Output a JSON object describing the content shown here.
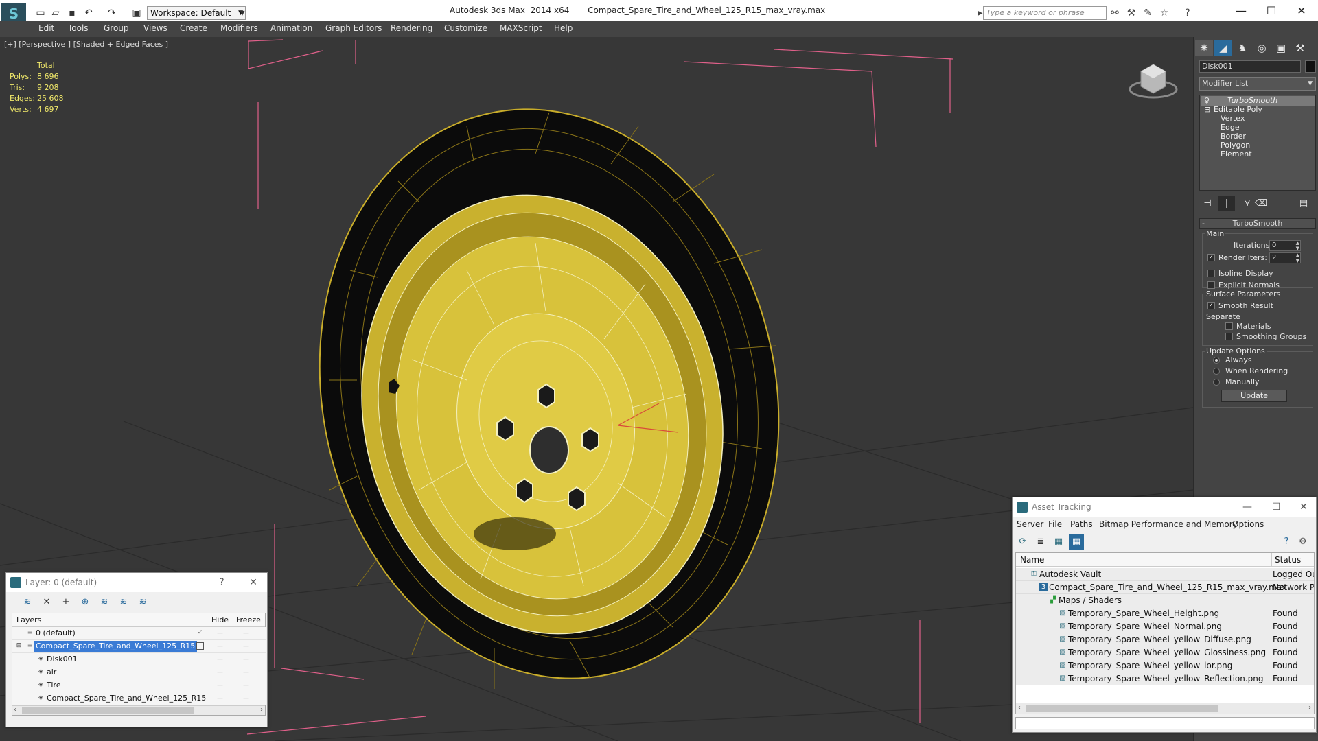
{
  "titlebar": {
    "workspace": "Workspace: Default",
    "app_title": "Autodesk 3ds Max  2014 x64",
    "file_name": "Compact_Spare_Tire_and_Wheel_125_R15_max_vray.max",
    "search_placeholder": "Type a keyword or phrase"
  },
  "menu": [
    "Edit",
    "Tools",
    "Group",
    "Views",
    "Create",
    "Modifiers",
    "Animation",
    "Graph Editors",
    "Rendering",
    "Customize",
    "MAXScript",
    "Help"
  ],
  "viewport": {
    "label": "[+] [Perspective ] [Shaded + Edged Faces ]",
    "stats": {
      "header": "Total",
      "rows": [
        {
          "key": "Polys:",
          "value": "8 696"
        },
        {
          "key": "Tris:",
          "value": "9 208"
        },
        {
          "key": "Edges:",
          "value": "25 608"
        },
        {
          "key": "Verts:",
          "value": "4 697"
        }
      ]
    },
    "colors": {
      "background": "#373737",
      "wire": "#e8d23a",
      "rim": "#c9b12e",
      "tire": "#0b0b0b",
      "bbox": "#e0608a"
    }
  },
  "command_panel": {
    "object_name": "Disk001",
    "modifier_list": "Modifier List",
    "stack": {
      "modifier": "TurboSmooth",
      "base": "Editable Poly",
      "sub_objects": [
        "Vertex",
        "Edge",
        "Border",
        "Polygon",
        "Element"
      ]
    },
    "turbosmooth": {
      "title": "TurboSmooth",
      "main_group": "Main",
      "iterations_label": "Iterations:",
      "iterations_value": "0",
      "render_iters_label": "Render Iters:",
      "render_iters_value": "2",
      "isoline_label": "Isoline Display",
      "explicit_label": "Explicit Normals",
      "surface_group": "Surface Parameters",
      "smooth_result_label": "Smooth Result",
      "separate_label": "Separate",
      "materials_label": "Materials",
      "smoothing_groups_label": "Smoothing Groups",
      "update_group": "Update Options",
      "always_label": "Always",
      "when_rendering_label": "When Rendering",
      "manually_label": "Manually",
      "update_button": "Update"
    }
  },
  "layer_window": {
    "title": "Layer: 0 (default)",
    "help": "?",
    "columns": {
      "layers": "Layers",
      "hide": "Hide",
      "freeze": "Freeze"
    },
    "rows": [
      {
        "name": "0 (default)"
      },
      {
        "name": "Compact_Spare_Tire_and_Wheel_125_R15"
      },
      {
        "name": "Disk001"
      },
      {
        "name": "air"
      },
      {
        "name": "Tire"
      },
      {
        "name": "Compact_Spare_Tire_and_Wheel_125_R15"
      }
    ]
  },
  "asset_window": {
    "title": "Asset Tracking",
    "menu": [
      "Server",
      "File",
      "Paths",
      "Bitmap Performance and Memory",
      "Options"
    ],
    "columns": {
      "name": "Name",
      "status": "Status"
    },
    "rows": [
      {
        "name": "Autodesk Vault",
        "status": "Logged Ou"
      },
      {
        "name": "Compact_Spare_Tire_and_Wheel_125_R15_max_vray.max",
        "status": "Network P"
      },
      {
        "name": "Maps / Shaders",
        "status": ""
      },
      {
        "name": "Temporary_Spare_Wheel_Height.png",
        "status": "Found"
      },
      {
        "name": "Temporary_Spare_Wheel_Normal.png",
        "status": "Found"
      },
      {
        "name": "Temporary_Spare_Wheel_yellow_Diffuse.png",
        "status": "Found"
      },
      {
        "name": "Temporary_Spare_Wheel_yellow_Glossiness.png",
        "status": "Found"
      },
      {
        "name": "Temporary_Spare_Wheel_yellow_ior.png",
        "status": "Found"
      },
      {
        "name": "Temporary_Spare_Wheel_yellow_Reflection.png",
        "status": "Found"
      }
    ]
  }
}
